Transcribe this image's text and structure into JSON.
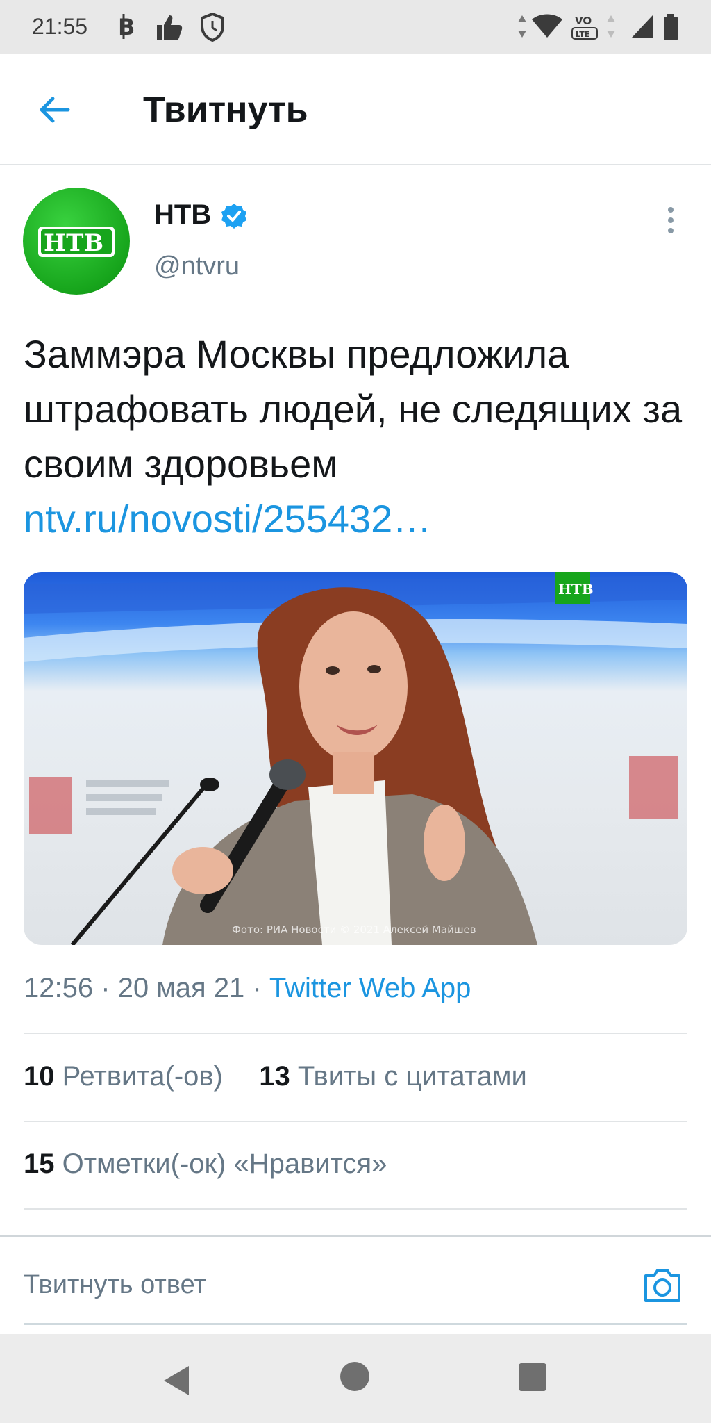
{
  "status_bar": {
    "time": "21:55",
    "icons": [
      "bitcoin-icon",
      "thumbs-up-icon",
      "shield-icon",
      "data-arrows-icon",
      "wifi-icon",
      "volte-icon",
      "signal-icon",
      "battery-icon"
    ],
    "volte_top": "VO",
    "volte_bottom": "LTE"
  },
  "header": {
    "title": "Твитнуть",
    "back_icon": "arrow-left-icon"
  },
  "tweet": {
    "author_name": "НТВ",
    "author_handle": "@ntvru",
    "verified": true,
    "text": "Заммэра Москвы предложила штрафовать людей, не следящих за своим здоровьем",
    "link": "ntv.ru/novosti/255432…",
    "media_watermark": "Фото: РИА Новости © 2021 Алексей Майшев",
    "media_logo": "НТВ",
    "time": "12:56",
    "date": "20 мая 21",
    "separator": "·",
    "source": "Twitter Web App"
  },
  "stats": {
    "retweets_count": "10",
    "retweets_label": "Ретвита(-ов)",
    "quotes_count": "13",
    "quotes_label": "Твиты с цитатами",
    "likes_count": "15",
    "likes_label": "Отметки(-ок) «Нравится»"
  },
  "reply": {
    "placeholder": "Твитнуть ответ"
  },
  "colors": {
    "accent": "#1b95e0",
    "text": "#14171a",
    "secondary": "#657786",
    "brand_green": "#17a51c"
  }
}
